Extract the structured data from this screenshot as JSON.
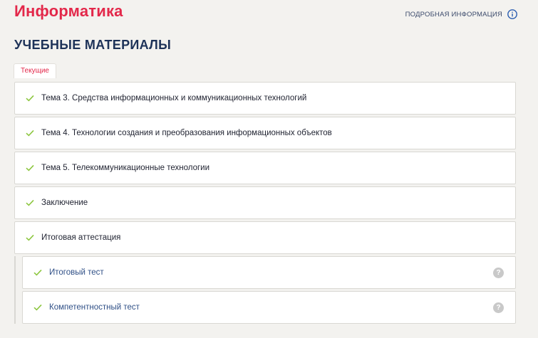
{
  "header": {
    "course_title": "Информатика",
    "info_link_label": "ПОДРОБНАЯ ИНФОРМАЦИЯ",
    "info_icon": "info-circle-icon"
  },
  "section": {
    "title": "УЧЕБНЫЕ МАТЕРИАЛЫ",
    "tab_label": "Текущие"
  },
  "topics": [
    {
      "label": "Тема 3. Средства информационных и коммуникационных технологий",
      "status_icon": "check-icon"
    },
    {
      "label": "Тема 4. Технологии создания и преобразования информационных объектов",
      "status_icon": "check-icon"
    },
    {
      "label": "Тема 5. Телекоммуникационные технологии",
      "status_icon": "check-icon"
    },
    {
      "label": "Заключение",
      "status_icon": "check-icon"
    },
    {
      "label": "Итоговая аттестация",
      "status_icon": "check-icon"
    }
  ],
  "subitems": [
    {
      "label": "Итоговый тест",
      "status_icon": "check-icon",
      "help_icon": "?"
    },
    {
      "label": "Компетентностный тест",
      "status_icon": "check-icon",
      "help_icon": "?"
    }
  ],
  "colors": {
    "accent": "#e3284a",
    "heading": "#1d3258",
    "link": "#2f4f86",
    "check": "#8cc63f",
    "background": "#f3f2ef"
  }
}
